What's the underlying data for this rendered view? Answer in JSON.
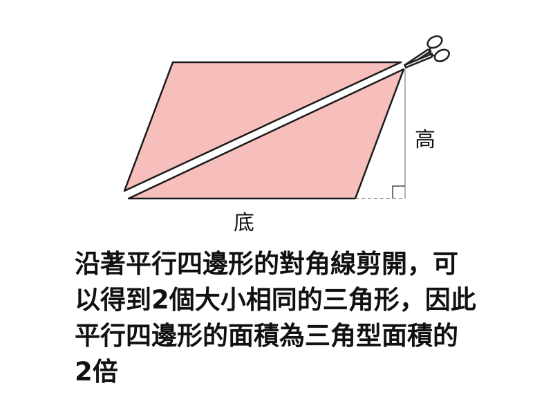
{
  "colors": {
    "fill": "#f6bfbc",
    "stroke": "#1a1a1a",
    "dash": "#888888"
  },
  "figure": {
    "icon": "scissors-icon",
    "labels": {
      "height": "高",
      "base": "底"
    }
  },
  "caption": {
    "lines": [
      "沿著平行四邊形的對角線剪開，可",
      "以得到2個大小相同的三角形，因此",
      "平行四邊形的面積為三角型面積的",
      "2倍"
    ]
  }
}
